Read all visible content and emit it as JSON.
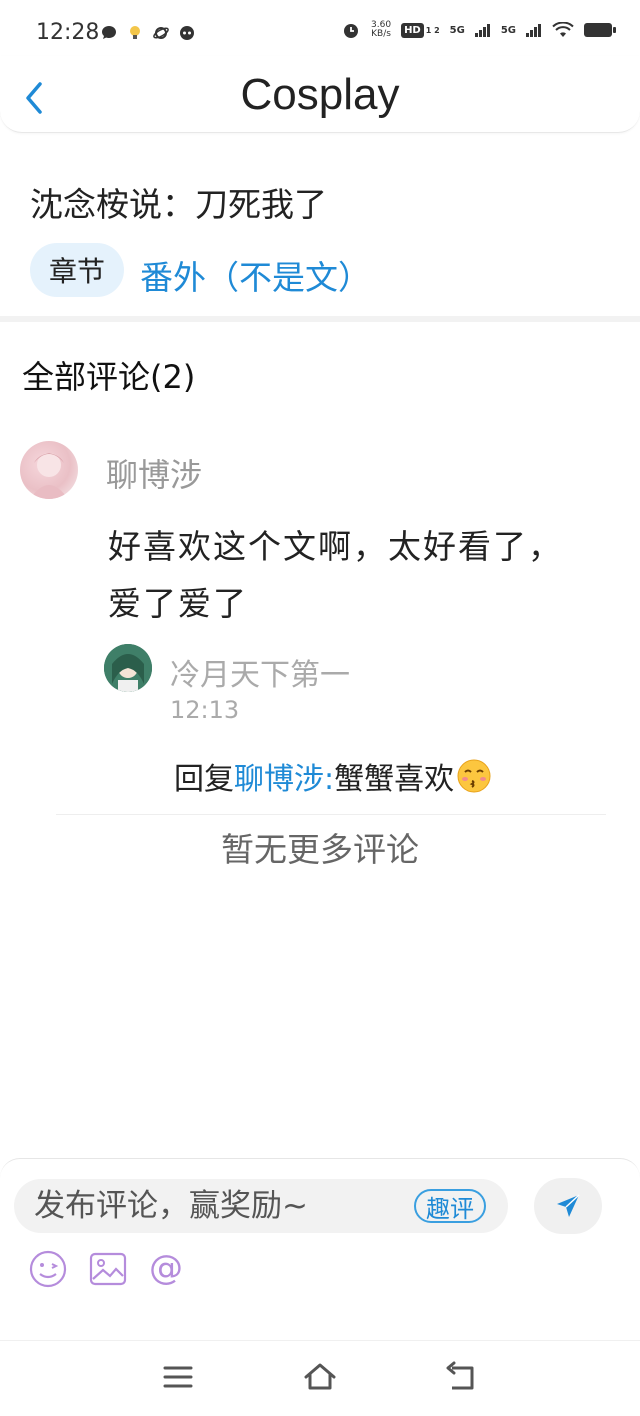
{
  "status_bar": {
    "time": "12:28",
    "net_speed_value": "3.60",
    "net_speed_unit": "KB/s",
    "hd_badge": "HD",
    "hd_sims": "1 2",
    "signal1_label": "5G",
    "signal2_label": "5G"
  },
  "header": {
    "title": "Cosplay",
    "back_icon": "chevron-left-icon"
  },
  "post": {
    "title": "沈念桉说：刀死我了",
    "tag": "章节",
    "chapter_link": "番外（不是文）"
  },
  "comments": {
    "heading": "全部评论(2)",
    "items": [
      {
        "username": "聊博涉",
        "text": "好喜欢这个文啊，太好看了，爱了爱了",
        "reply": {
          "username": "冷月天下第一",
          "time": "12:13",
          "prefix": "回复",
          "mention": "聊博涉:",
          "text": "蟹蟹喜欢",
          "emoji": "kissing-face-emoji"
        }
      }
    ],
    "end_text": "暂无更多评论"
  },
  "composer": {
    "placeholder": "发布评论，赢奖励~",
    "qu_ping_label": "趣评",
    "send_icon": "send-icon",
    "tools": [
      "emoji-icon",
      "image-icon",
      "mention-icon"
    ]
  },
  "colors": {
    "accent": "#1f8ad6",
    "chip_bg": "#e5f2fc",
    "icon_purple": "#b58cdc"
  }
}
